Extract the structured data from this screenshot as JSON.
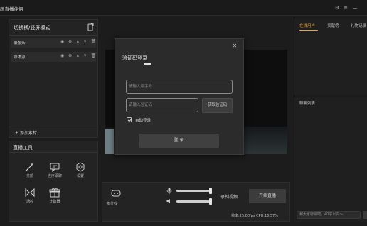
{
  "app": {
    "title": "画直播伴侣"
  },
  "titlebar": {
    "icons": [
      "settings-icon",
      "menu-icon",
      "minimize-icon"
    ]
  },
  "scene_panel": {
    "title": "切换横/竖屏模式",
    "sources": [
      {
        "label": "摄像头",
        "icons": "◉ ⊖ ∧ ∨ 🗑"
      },
      {
        "label": "媒体源",
        "icons": "◉ ⊖ ∧ ∨ 🗑"
      }
    ],
    "add_source": "+ 添加素材"
  },
  "tools_panel": {
    "title": "直播工具",
    "tools": [
      {
        "label": "美颜",
        "icon": "magic-wand-icon"
      },
      {
        "label": "连序耶聊",
        "icon": "chat-icon"
      },
      {
        "label": "设置",
        "icon": "settings-icon"
      },
      {
        "label": "场控",
        "icon": "bowtie-icon"
      },
      {
        "label": "计数器",
        "icon": "gift-icon"
      }
    ]
  },
  "controls": {
    "gamepad_label": "指位找",
    "record_label": "录制视频",
    "start_label": "开始直播",
    "mic_volume": 1.0,
    "speaker_volume": 1.0
  },
  "status": {
    "stats": "帧率:25.00fps  CPU:16.57%"
  },
  "right_panel": {
    "tabs": [
      "在线用户",
      "贡献榜",
      "礼物记录"
    ],
    "active_tab": 0,
    "chat_title": "聊聊列表",
    "chat_placeholder": "和大家聊聊吧，40字以内～"
  },
  "login_modal": {
    "title": "验证码登录",
    "phone_placeholder": "请输入原手号",
    "code_placeholder": "请输入验证码",
    "get_code_label": "获取验证码",
    "auto_login_label": "自动登录",
    "auto_login_checked": true,
    "login_label": "登 录",
    "close_icon": "close-icon"
  },
  "colors": {
    "accent": "#e8a33c",
    "background": "#1c1c1c",
    "panel": "#232323",
    "modal": "#2b2b2b"
  }
}
